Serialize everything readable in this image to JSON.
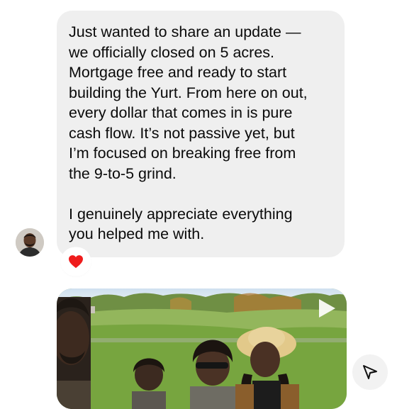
{
  "message": {
    "paragraph_1": "Just wanted to share an update —\nwe officially closed on 5 acres.\nMortgage free and ready to start\nbuilding the Yurt. From here on out,\nevery dollar that comes in is pure\ncash flow. It’s not passive yet, but\nI’m focused on breaking free from\nthe 9-to-5 grind.",
    "paragraph_2": "I genuinely appreciate everything\nyou helped me with."
  },
  "reaction": {
    "icon": "heart-icon",
    "color": "#ef1c1c"
  },
  "media": {
    "type": "video",
    "icon": "play-icon"
  },
  "actions": {
    "share_icon": "send-icon"
  },
  "colors": {
    "bubble_bg": "#efefef",
    "text": "#0a0a0a"
  }
}
